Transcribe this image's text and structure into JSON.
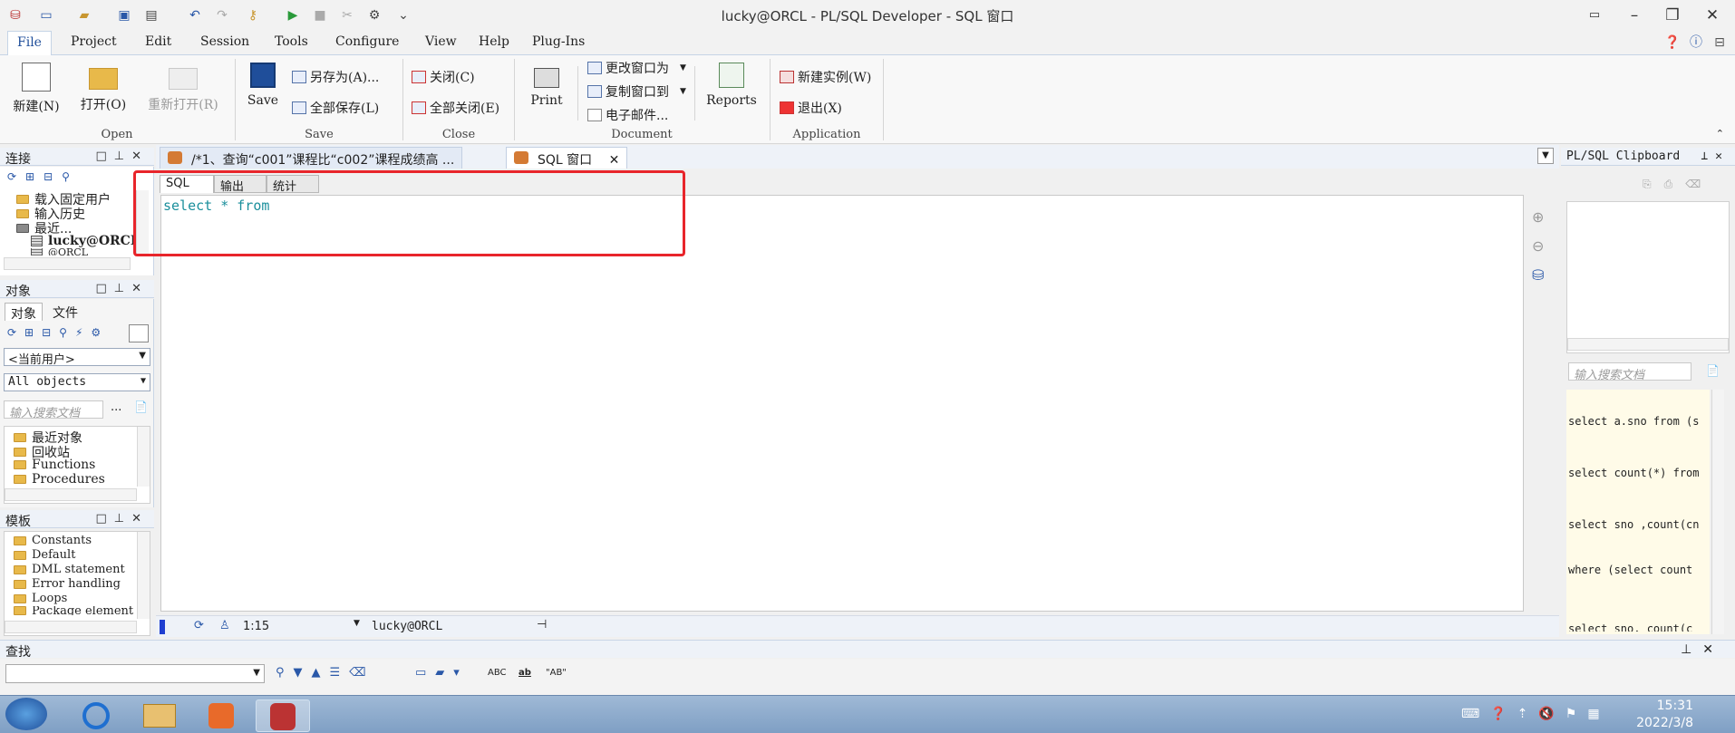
{
  "window": {
    "title": "lucky@ORCL - PL/SQL Developer - SQL 窗口"
  },
  "menu": [
    "File",
    "Project",
    "Edit",
    "Session",
    "Tools",
    "Configure",
    "View",
    "Help",
    "Plug-Ins"
  ],
  "ribbon": {
    "open_group": {
      "label": "Open",
      "new": "新建(N)",
      "open": "打开(O)",
      "reopen": "重新打开(R)"
    },
    "save_group": {
      "label": "Save",
      "save": "Save",
      "save_as": "另存为(A)...",
      "save_all": "全部保存(L)"
    },
    "close_group": {
      "label": "Close",
      "close": "关闭(C)",
      "close_all": "全部关闭(E)"
    },
    "document_group": {
      "label": "Document",
      "print": "Print",
      "change_window": "更改窗口为",
      "copy_window": "复制窗口到",
      "email": "电子邮件...",
      "reports": "Reports"
    },
    "application_group": {
      "label": "Application",
      "new_instance": "新建实例(W)",
      "exit": "退出(X)"
    }
  },
  "connection_panel": {
    "title": "连接",
    "items": [
      "载入固定用户",
      "输入历史",
      "最近...",
      "lucky@ORCL",
      "@ORCL"
    ]
  },
  "object_panel": {
    "title": "对象",
    "tabs": [
      "对象",
      "文件"
    ],
    "user_select": "<当前用户>",
    "object_filter": "All objects",
    "search_placeholder": "输入搜索文档",
    "more": "...",
    "items": [
      "最近对象",
      "回收站",
      "Functions",
      "Procedures"
    ]
  },
  "template_panel": {
    "title": "模板",
    "items": [
      "Constants",
      "Default",
      "DML statement",
      "Error handling",
      "Loops",
      "Package element"
    ]
  },
  "doc_tabs": [
    {
      "label": "/*1、查询“c001”课程比“c002”课程成绩高 ..."
    },
    {
      "label": "SQL 窗口"
    }
  ],
  "sub_tabs": [
    "SQL",
    "输出",
    "统计"
  ],
  "editor": {
    "sql_text": "select * from"
  },
  "status": {
    "position": "1:15",
    "connection": "lucky@ORCL"
  },
  "find": {
    "title": "查找",
    "buttons": [
      "ABC",
      "ab",
      "\"AB\""
    ]
  },
  "clipboard": {
    "title": "PL/SQL Clipboard",
    "search_placeholder": "输入搜索文档",
    "items": [
      "select a.sno from (s",
      "select count(*) from",
      "select sno ,count(cn",
      "where (select count",
      "select sno, count(c"
    ]
  },
  "taskbar": {
    "time": "15:31",
    "date": "2022/3/8"
  },
  "colors": {
    "highlight": "#e8252b",
    "sql_keyword": "#1b8f9c"
  }
}
